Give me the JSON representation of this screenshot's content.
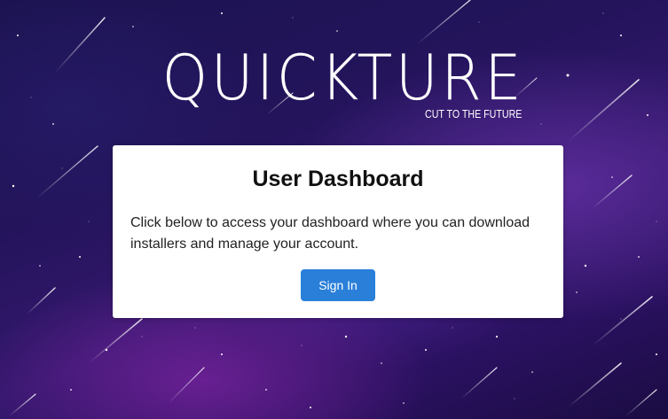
{
  "logo": {
    "title": "QUICKTURE",
    "tagline": "CUT TO THE FUTURE"
  },
  "card": {
    "title": "User Dashboard",
    "description": "Click below to access your dashboard where you can download installers and manage your account.",
    "button_label": "Sign In"
  },
  "colors": {
    "button": "#2a7fd9",
    "card_background": "#ffffff",
    "page_background": "#24145c"
  }
}
